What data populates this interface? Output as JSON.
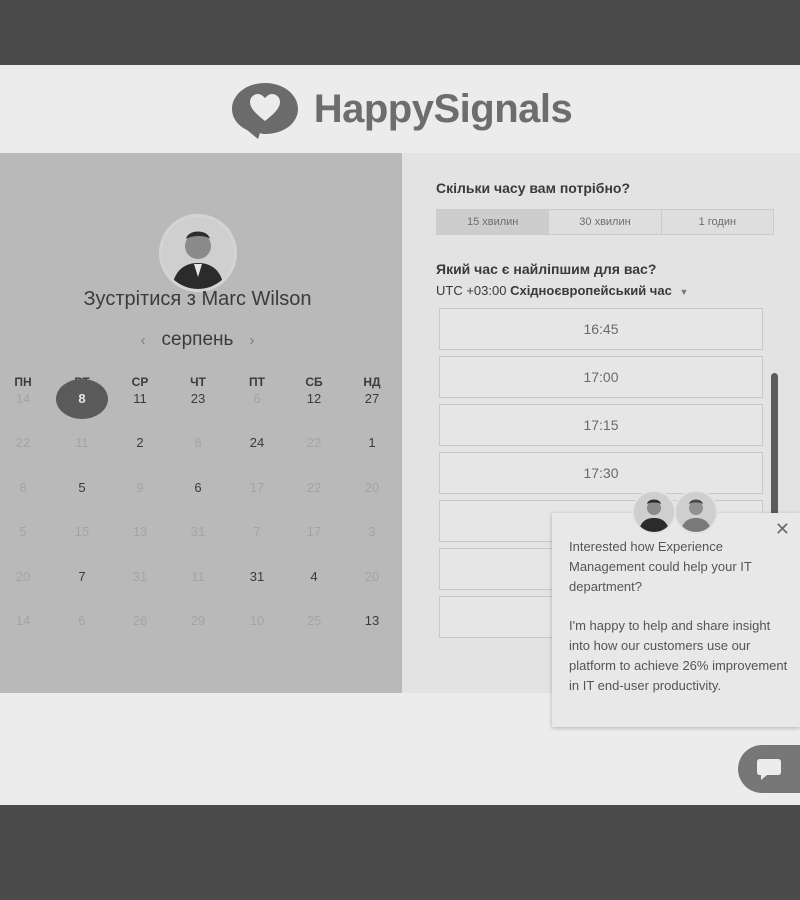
{
  "brand": {
    "name": "HappySignals"
  },
  "host": {
    "title": "Зустрітися з Marc Wilson"
  },
  "calendar": {
    "month": "серпень",
    "weekdays": [
      "ПН",
      "ВТ",
      "СР",
      "ЧТ",
      "ПТ",
      "СБ",
      "НД"
    ],
    "weeks": [
      [
        {
          "d": "14",
          "on": false
        },
        {
          "d": "8",
          "on": true,
          "sel": true
        },
        {
          "d": "11",
          "on": true
        },
        {
          "d": "23",
          "on": true
        },
        {
          "d": "6",
          "on": false
        },
        {
          "d": "12",
          "on": true
        },
        {
          "d": "27",
          "on": true
        }
      ],
      [
        {
          "d": "22",
          "on": false
        },
        {
          "d": "11",
          "on": false
        },
        {
          "d": "2",
          "on": true
        },
        {
          "d": "8",
          "on": false
        },
        {
          "d": "24",
          "on": true
        },
        {
          "d": "22",
          "on": false
        },
        {
          "d": "1",
          "on": true
        }
      ],
      [
        {
          "d": "8",
          "on": false
        },
        {
          "d": "5",
          "on": true
        },
        {
          "d": "9",
          "on": false
        },
        {
          "d": "6",
          "on": true
        },
        {
          "d": "17",
          "on": false
        },
        {
          "d": "22",
          "on": false
        },
        {
          "d": "20",
          "on": false
        }
      ],
      [
        {
          "d": "5",
          "on": false
        },
        {
          "d": "15",
          "on": false
        },
        {
          "d": "13",
          "on": false
        },
        {
          "d": "31",
          "on": false
        },
        {
          "d": "7",
          "on": false
        },
        {
          "d": "17",
          "on": false
        },
        {
          "d": "3",
          "on": false
        }
      ],
      [
        {
          "d": "20",
          "on": false
        },
        {
          "d": "7",
          "on": true
        },
        {
          "d": "31",
          "on": false
        },
        {
          "d": "11",
          "on": false
        },
        {
          "d": "31",
          "on": true
        },
        {
          "d": "4",
          "on": true
        },
        {
          "d": "20",
          "on": false
        }
      ],
      [
        {
          "d": "14",
          "on": false
        },
        {
          "d": "6",
          "on": false
        },
        {
          "d": "26",
          "on": false
        },
        {
          "d": "29",
          "on": false
        },
        {
          "d": "10",
          "on": false
        },
        {
          "d": "25",
          "on": false
        },
        {
          "d": "13",
          "on": true
        }
      ]
    ]
  },
  "duration": {
    "question": "Скільки часу вам потрібно?",
    "options": [
      "15 хвилин",
      "30 хвилин",
      "1 годин"
    ],
    "selected": 0
  },
  "time": {
    "question": "Який час є найліпшим для вас?",
    "timezone_offset": "UTC +03:00",
    "timezone_name": "Східноєвропейський час",
    "slots": [
      "16:45",
      "17:00",
      "17:15",
      "17:30",
      "",
      "",
      ""
    ]
  },
  "popup": {
    "message1": "Interested how Experience Management could help your IT department?",
    "message2": "I'm happy to help and share insight into how our customers use our platform to achieve 26% improvement in IT end-user productivity.",
    "close_icon": "close-icon"
  }
}
